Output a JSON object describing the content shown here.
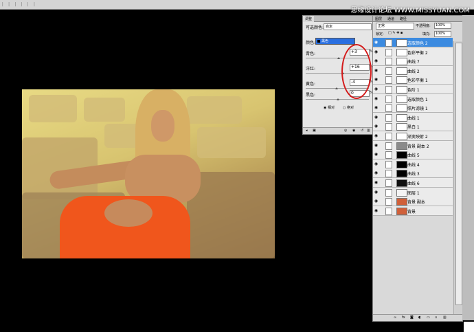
{
  "watermark": "思缘设计论坛 WWW.MISSYUAN.COM",
  "ruler": "| | | | | |",
  "adjust": {
    "tab": "调整",
    "preset_label": "可选颜色:",
    "preset_value": "自定",
    "colors_label": "颜色:",
    "colors_value": "黑色",
    "rows": [
      {
        "label": "青色:",
        "value": "+3"
      },
      {
        "label": "洋红:",
        "value": "+16"
      },
      {
        "label": "黄色:",
        "value": "-4"
      },
      {
        "label": "黑色:",
        "value": "0"
      }
    ],
    "percent": "%",
    "radio_relative": "相对",
    "radio_absolute": "绝对"
  },
  "layers": {
    "tabs": [
      "图层",
      "通道",
      "路径"
    ],
    "blend": "正常",
    "opacity_label": "不透明度:",
    "opacity": "100%",
    "lock_label": "锁定:",
    "fill_label": "填充:",
    "fill": "100%",
    "items": [
      {
        "name": "选取颜色 2",
        "selected": true
      },
      {
        "name": "色彩平衡 2"
      },
      {
        "name": "曲线 7"
      },
      {
        "name": "曲线 2"
      },
      {
        "name": "色彩平衡 1"
      },
      {
        "name": "色阶 1"
      },
      {
        "name": "选取颜色 1"
      },
      {
        "name": "照片滤镜 1"
      },
      {
        "name": "曲线 1"
      },
      {
        "name": "黑白 1"
      },
      {
        "name": "渐变映射 2"
      },
      {
        "name": "背景 副本 2"
      },
      {
        "name": "曲线 5"
      },
      {
        "name": "曲线 4"
      },
      {
        "name": "曲线 3"
      },
      {
        "name": "曲线 6"
      },
      {
        "name": "图层 1"
      },
      {
        "name": "背景 副本"
      },
      {
        "name": "背景"
      }
    ]
  }
}
